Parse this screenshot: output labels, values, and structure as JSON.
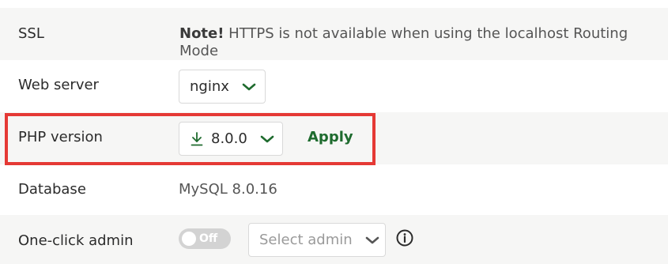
{
  "rows": {
    "ssl": {
      "label": "SSL",
      "note_strong": "Note!",
      "note_text": " HTTPS is not available when using the localhost Routing Mode"
    },
    "web_server": {
      "label": "Web server",
      "selected": "nginx"
    },
    "php_version": {
      "label": "PHP version",
      "selected": "8.0.0",
      "apply_label": "Apply"
    },
    "database": {
      "label": "Database",
      "value": "MySQL 8.0.16"
    },
    "one_click_admin": {
      "label": "One-click admin",
      "toggle_text": "Off",
      "toggle_state": "off",
      "select_placeholder": "Select admin"
    }
  },
  "colors": {
    "accent_green": "#1e6b2e",
    "highlight_red": "#e53935",
    "alt_row_bg": "#f6f6f5"
  },
  "icons": {
    "chevron": "chevron-down-icon",
    "download": "download-icon",
    "info": "info-icon"
  }
}
